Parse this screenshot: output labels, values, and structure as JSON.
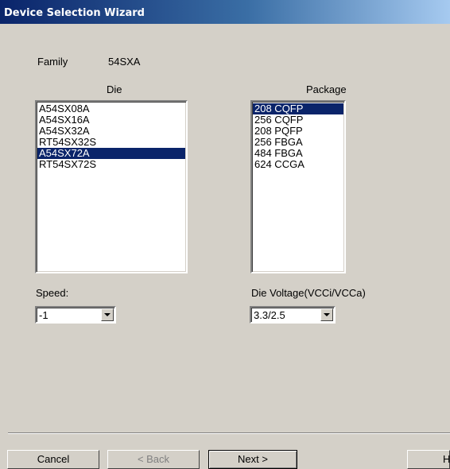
{
  "window": {
    "title": "Device Selection Wizard"
  },
  "family": {
    "label": "Family",
    "value": "54SXA"
  },
  "die": {
    "header": "Die",
    "items": [
      "A54SX08A",
      "A54SX16A",
      "A54SX32A",
      "RT54SX32S",
      "A54SX72A",
      "RT54SX72S"
    ],
    "selected": "A54SX72A"
  },
  "package": {
    "header": "Package",
    "items": [
      "208 CQFP",
      "256 CQFP",
      "208 PQFP",
      "256 FBGA",
      "484 FBGA",
      "624 CCGA"
    ],
    "selected": "208 CQFP"
  },
  "speed": {
    "label": "Speed:",
    "value": "-1"
  },
  "voltage": {
    "label": "Die Voltage(VCCi/VCCa)",
    "value": "3.3/2.5"
  },
  "buttons": {
    "cancel": "Cancel",
    "back": "< Back",
    "next": "Next >",
    "help": "Help"
  }
}
